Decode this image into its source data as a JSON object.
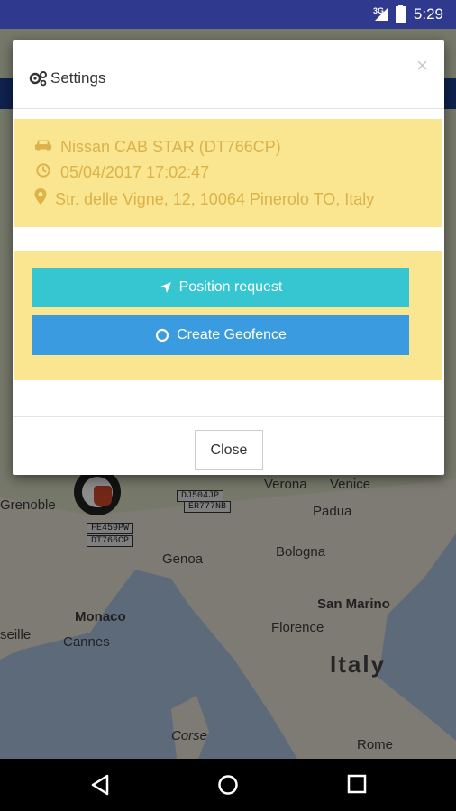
{
  "status_bar": {
    "network": "3G",
    "time": "5:29"
  },
  "map": {
    "labels": {
      "verona": "Verona",
      "venice": "Venice",
      "padua": "Padua",
      "bologna": "Bologna",
      "genoa": "Genoa",
      "florence": "Florence",
      "san_marino": "San Marino",
      "italy": "Italy",
      "monaco": "Monaco",
      "cannes": "Cannes",
      "seille": "seille",
      "grenoble": "Grenoble",
      "corse": "Corse",
      "rome": "Rome"
    },
    "plates": [
      "DJ504JP",
      "ER777NB",
      "FE459PW",
      "DT766CP"
    ]
  },
  "dialog": {
    "title": "Settings",
    "vehicle": "Nissan CAB STAR (DT766CP)",
    "datetime": "05/04/2017 17:02:47",
    "address": "Str. delle Vigne, 12, 10064 Pinerolo TO, Italy",
    "position_request_label": "Position request",
    "create_geofence_label": "Create Geofence",
    "close_label": "Close",
    "close_x": "×"
  },
  "colors": {
    "info_bg": "#fae591",
    "info_text": "#dcb24a",
    "position_btn": "#35c6d1",
    "geofence_btn": "#3a9be0"
  }
}
